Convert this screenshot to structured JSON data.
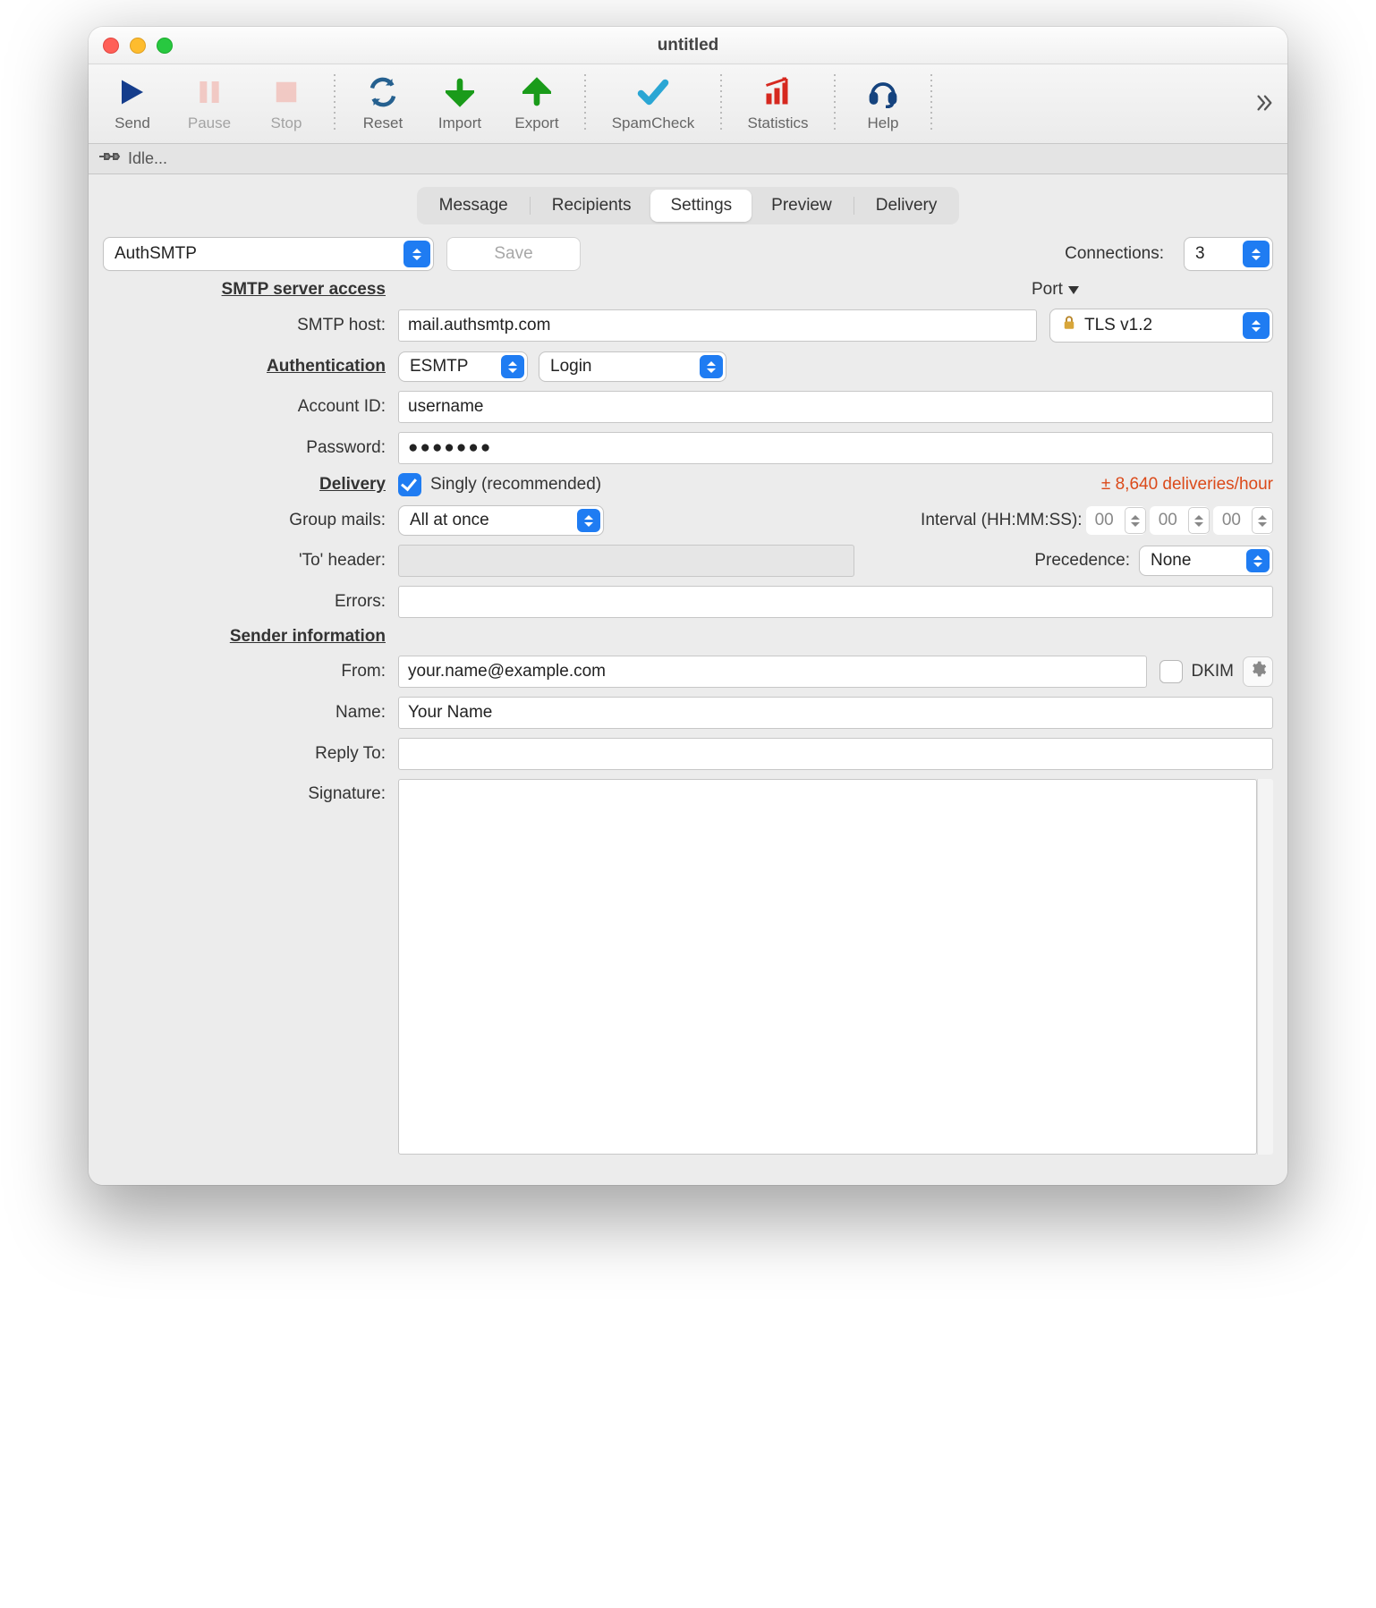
{
  "window": {
    "title": "untitled"
  },
  "toolbar": {
    "send": "Send",
    "pause": "Pause",
    "stop": "Stop",
    "reset": "Reset",
    "import": "Import",
    "export": "Export",
    "spamcheck": "SpamCheck",
    "statistics": "Statistics",
    "help": "Help"
  },
  "status": {
    "text": "Idle..."
  },
  "tabs": [
    "Message",
    "Recipients",
    "Settings",
    "Preview",
    "Delivery"
  ],
  "active_tab": "Settings",
  "profile": {
    "selected": "AuthSMTP",
    "save_label": "Save",
    "connections_label": "Connections:",
    "connections_value": "3"
  },
  "sections": {
    "smtp_header": "SMTP server access",
    "port_label": "Port",
    "smtp_host_label": "SMTP host:",
    "smtp_host_value": "mail.authsmtp.com",
    "tls_value": "TLS v1.2",
    "auth_header": "Authentication",
    "auth_proto": "ESMTP",
    "auth_method": "Login",
    "account_label": "Account ID:",
    "account_value": "username",
    "password_label": "Password:",
    "password_value": "●●●●●●●",
    "delivery_header": "Delivery",
    "singly_label": "Singly (recommended)",
    "rate_text": "± 8,640 deliveries/hour",
    "group_label": "Group mails:",
    "group_value": "All at once",
    "interval_label": "Interval (HH:MM:SS):",
    "interval_hh": "00",
    "interval_mm": "00",
    "interval_ss": "00",
    "to_header_label": "'To' header:",
    "to_header_value": "",
    "precedence_label": "Precedence:",
    "precedence_value": "None",
    "errors_label": "Errors:",
    "errors_value": "",
    "sender_header": "Sender information",
    "from_label": "From:",
    "from_value": "your.name@example.com",
    "dkim_label": "DKIM",
    "name_label": "Name:",
    "name_value": "Your Name",
    "reply_label": "Reply To:",
    "reply_value": "",
    "signature_label": "Signature:",
    "signature_value": ""
  }
}
